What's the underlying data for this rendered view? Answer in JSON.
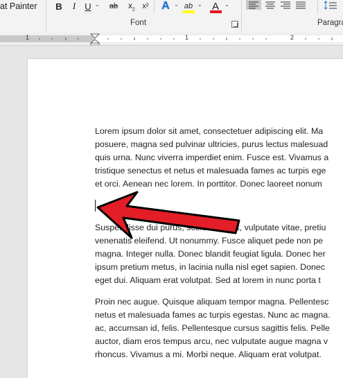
{
  "ribbon": {
    "format_painter_label": "at Painter",
    "font_group_label": "Font",
    "paragraph_group_label": "Paragra",
    "bold_label": "B",
    "italic_label": "I",
    "underline_label": "U",
    "strikethrough_label": "ab",
    "subscript_label": "x",
    "subscript_index": "2",
    "text_effects_label": "A",
    "highlight_label": "ab",
    "font_color_label": "A",
    "highlight_color": "#ffff00",
    "font_color": "#e81123",
    "icons": [
      "bold-icon",
      "italic-icon",
      "underline-icon",
      "strikethrough-icon",
      "subscript-icon",
      "text-effects-icon",
      "highlight-icon",
      "font-color-icon",
      "align-left-icon",
      "align-center-icon",
      "align-right-icon",
      "justify-icon",
      "line-spacing-icon"
    ]
  },
  "ruler": {
    "numbers": [
      "1",
      "1",
      "2"
    ]
  },
  "document": {
    "paragraphs": [
      {
        "lines": [
          "Lorem ipsum dolor sit amet, consectetuer adipiscing elit. Ma",
          "posuere, magna sed pulvinar ultricies, purus lectus malesuad",
          "quis urna. Nunc viverra imperdiet enim. Fusce est. Vivamus a",
          "tristique senectus et netus et malesuada fames ac turpis ege",
          "et orci. Aenean nec lorem. In porttitor. Donec laoreet nonum"
        ]
      },
      {
        "lines": [
          "Suspendisse dui purus, scelerisque at, vulputate vitae, pretiu",
          "venenatis eleifend. Ut nonummy. Fusce aliquet pede non pe",
          "magna. Integer nulla. Donec blandit feugiat ligula. Donec her",
          "ipsum pretium metus, in lacinia nulla nisl eget sapien. Donec",
          "eget dui. Aliquam erat volutpat. Sed at lorem in nunc porta t"
        ]
      },
      {
        "lines": [
          "Proin nec augue. Quisque aliquam tempor magna. Pellentesc",
          "netus et malesuada fames ac turpis egestas. Nunc ac magna.",
          "ac, accumsan id, felis. Pellentesque cursus sagittis felis. Pelle",
          "auctor, diam eros tempus arcu, nec vulputate augue magna v",
          "rhoncus. Vivamus a mi. Morbi neque. Aliquam erat volutpat."
        ]
      }
    ]
  },
  "annotation": {
    "arrow_color": "#e41e26",
    "arrow_outline": "#000000"
  }
}
